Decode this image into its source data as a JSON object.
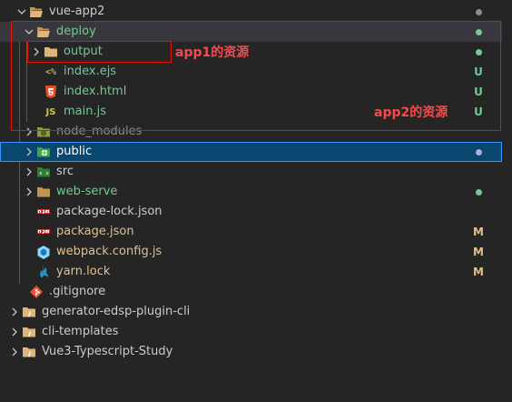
{
  "tree": {
    "items": [
      {
        "label": "vue-app2",
        "status": "",
        "type": "folder-open"
      },
      {
        "label": "deploy",
        "status": "",
        "type": "folder-open"
      },
      {
        "label": "output",
        "status": "",
        "type": "folder"
      },
      {
        "label": "index.ejs",
        "status": "U",
        "type": "ejs"
      },
      {
        "label": "index.html",
        "status": "U",
        "type": "html"
      },
      {
        "label": "main.js",
        "status": "U",
        "type": "js"
      },
      {
        "label": "node_modules",
        "status": "",
        "type": "node-folder"
      },
      {
        "label": "public",
        "status": "",
        "type": "public-folder"
      },
      {
        "label": "src",
        "status": "",
        "type": "src-folder"
      },
      {
        "label": "web-serve",
        "status": "",
        "type": "folder"
      },
      {
        "label": "package-lock.json",
        "status": "",
        "type": "npm"
      },
      {
        "label": "package.json",
        "status": "M",
        "type": "npm"
      },
      {
        "label": "webpack.config.js",
        "status": "M",
        "type": "webpack"
      },
      {
        "label": "yarn.lock",
        "status": "M",
        "type": "yarn"
      },
      {
        "label": ".gitignore",
        "status": "",
        "type": "git"
      },
      {
        "label": "generator-edsp-plugin-cli",
        "status": "",
        "type": "folder-yellow"
      },
      {
        "label": "cli-templates",
        "status": "",
        "type": "folder-yellow"
      },
      {
        "label": "Vue3-Typescript-Study",
        "status": "",
        "type": "folder-yellow"
      }
    ]
  },
  "annotations": {
    "app1": "app1的资源",
    "app2": "app2的资源"
  },
  "icon_glyphs": {
    "ejs": "<%",
    "js": "JS"
  },
  "colors": {
    "untracked": "#73c991",
    "modified": "#e2c08d",
    "selection": "#094771",
    "annotation": "#e51400"
  }
}
